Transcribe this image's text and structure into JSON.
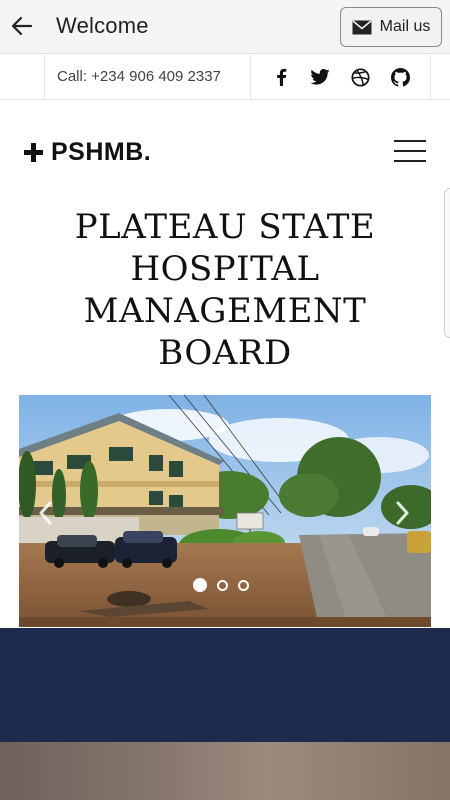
{
  "appbar": {
    "back_icon": "arrow-left-icon",
    "title": "Welcome",
    "mail_icon": "envelope-icon",
    "mail_label": "Mail us"
  },
  "topbar": {
    "call_text": "Call: +234 906 409 2337",
    "social_icons": [
      "facebook-icon",
      "twitter-icon",
      "dribbble-icon",
      "github-icon"
    ]
  },
  "brand": {
    "logo_text": "PSHMB."
  },
  "hero": {
    "headline_lines": [
      "PLATEAU STATE",
      "HOSPITAL",
      "MANAGEMENT",
      "BOARD"
    ]
  },
  "carousel": {
    "slide_count": 3,
    "active_index": 0
  },
  "colors": {
    "navy_band": "#1f2a4f",
    "appbar_bg": "#f5f5f5"
  }
}
